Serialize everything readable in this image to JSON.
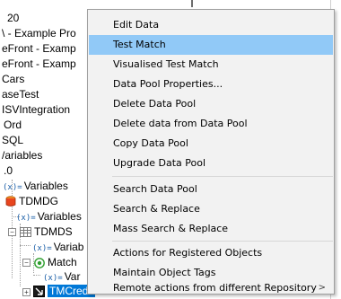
{
  "tree": {
    "items": [
      {
        "label": "20"
      },
      {
        "label": "\\ - Example Pro"
      },
      {
        "label": "eFront - Examp"
      },
      {
        "label": "eFront - Examp"
      },
      {
        "label": "Cars"
      },
      {
        "label": "aseTest"
      },
      {
        "label": "ISVIntegration"
      },
      {
        "label": "Ord"
      },
      {
        "label": "SQL"
      },
      {
        "label": "/ariables"
      },
      {
        "label": ".0"
      },
      {
        "label": "Variables",
        "icon": "(x)="
      },
      {
        "label": "TDMDG"
      },
      {
        "label": "Variables",
        "icon": "(x)="
      },
      {
        "label": "TDMDS"
      },
      {
        "label": "Variab",
        "icon": "(x)="
      },
      {
        "label": "Match"
      },
      {
        "label": "Var",
        "icon": "(x)="
      },
      {
        "label": "TMCredit"
      }
    ]
  },
  "menu": {
    "items": [
      {
        "label": "Edit Data"
      },
      {
        "label": "Test Match"
      },
      {
        "label": "Visualised Test Match"
      },
      {
        "label": "Data Pool Properties..."
      },
      {
        "label": "Delete Data Pool"
      },
      {
        "label": "Delete data from Data Pool"
      },
      {
        "label": "Copy Data Pool"
      },
      {
        "label": "Upgrade Data Pool"
      },
      {
        "label": "Search Data Pool"
      },
      {
        "label": "Search & Replace"
      },
      {
        "label": "Mass Search & Replace"
      },
      {
        "label": "Actions for Registered Objects"
      },
      {
        "label": "Maintain Object Tags"
      },
      {
        "label": "Remote actions from different Repository"
      }
    ],
    "submenu_arrow": ">",
    "highlight_color": "#91c9f7"
  }
}
